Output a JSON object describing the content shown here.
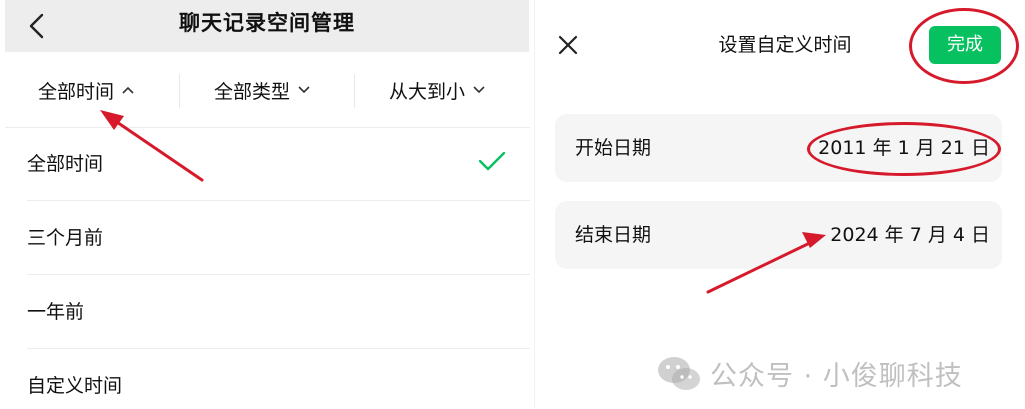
{
  "left": {
    "title": "聊天记录空间管理",
    "filters": [
      {
        "label": "全部时间",
        "chevron": "up"
      },
      {
        "label": "全部类型",
        "chevron": "down"
      },
      {
        "label": "从大到小",
        "chevron": "down"
      }
    ],
    "options": [
      {
        "label": "全部时间",
        "selected": true
      },
      {
        "label": "三个月前",
        "selected": false
      },
      {
        "label": "一年前",
        "selected": false
      },
      {
        "label": "自定义时间",
        "selected": false
      }
    ]
  },
  "right": {
    "title": "设置自定义时间",
    "done_label": "完成",
    "start": {
      "label": "开始日期",
      "value": "2011 年 1 月 21 日"
    },
    "end": {
      "label": "结束日期",
      "value": "2024 年 7 月 4 日"
    }
  },
  "watermark": {
    "text": "公众号 · 小俊聊科技"
  },
  "colors": {
    "accent_green": "#07c160",
    "annotation_red": "#d61a2b",
    "header_gray": "#ededed",
    "card_gray": "#f5f5f5"
  },
  "icons": {
    "back": "chevron-left-icon",
    "close": "close-icon",
    "check": "checkmark-icon",
    "chevron_up": "chevron-up-icon",
    "chevron_down": "chevron-down-icon",
    "watermark": "wechat-logo-icon"
  }
}
